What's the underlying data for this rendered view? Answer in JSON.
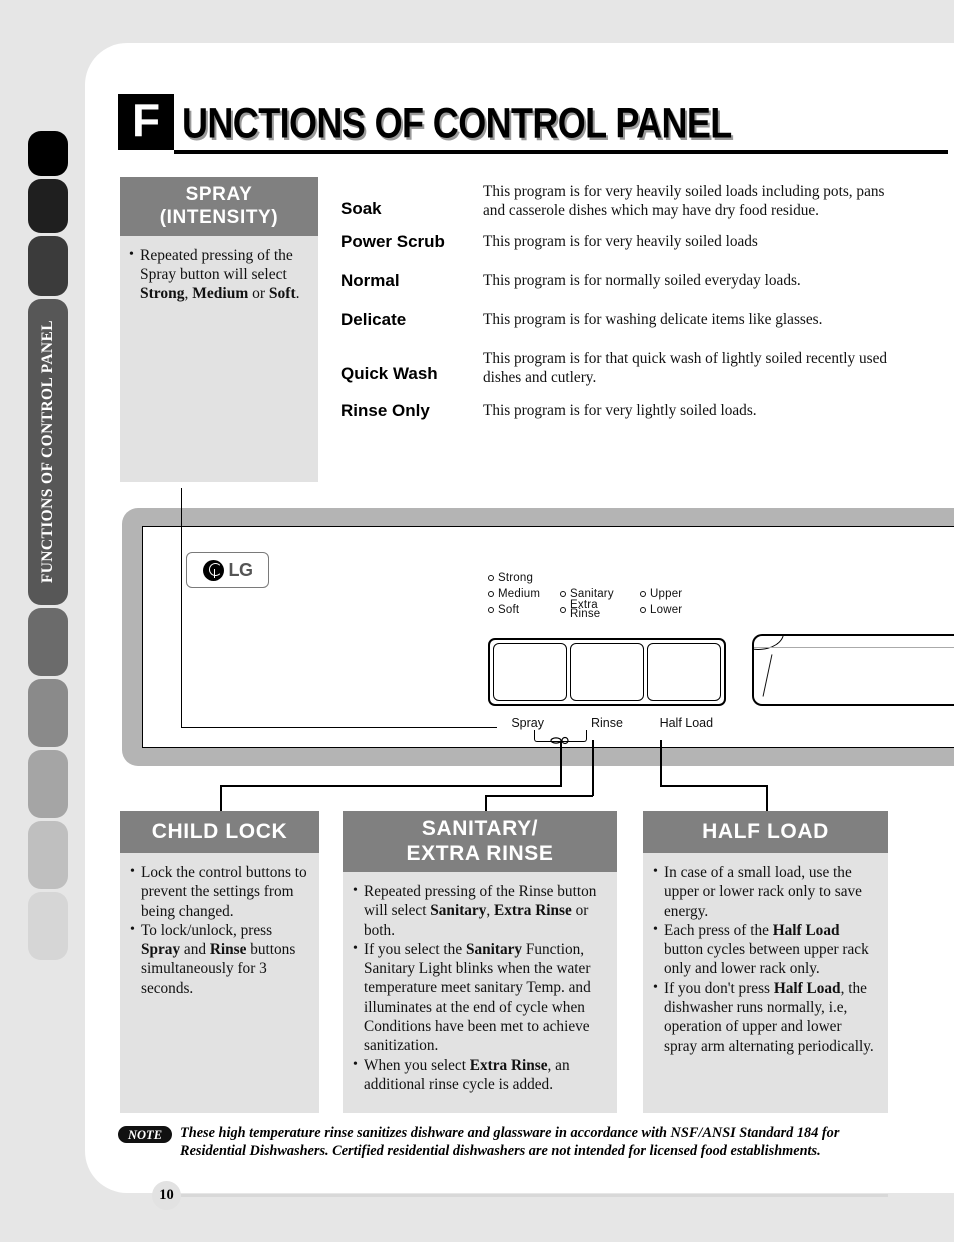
{
  "page": {
    "number": "10",
    "side_tab_label": "FUNCTIONS OF CONTROL PANEL"
  },
  "header": {
    "drop_cap": "F",
    "title": "UNCTIONS OF CONTROL PANEL"
  },
  "spray_panel": {
    "title_line1": "SPRAY",
    "title_line2": "(INTENSITY)",
    "bullets": [
      "Repeated pressing of the Spray button will select Strong, Medium or Soft."
    ]
  },
  "programs": [
    {
      "name": "Soak",
      "description": "This program is for very heavily soiled loads including pots, pans and casserole dishes which may have dry food residue."
    },
    {
      "name": "Power Scrub",
      "description": "This program is for very heavily soiled loads"
    },
    {
      "name": "Normal",
      "description": "This program is for normally soiled everyday loads."
    },
    {
      "name": "Delicate",
      "description": "This program is for washing delicate items like glasses."
    },
    {
      "name": "Quick Wash",
      "description": "This program is for that quick wash of lightly soiled recently used dishes and cutlery."
    },
    {
      "name": "Rinse Only",
      "description": "This program is for very lightly soiled  loads."
    }
  ],
  "control_panel": {
    "brand": "LG",
    "indicators_col1": [
      "Strong",
      "Medium",
      "Soft"
    ],
    "indicators_col2": [
      "Sanitary",
      "Extra",
      "Rinse"
    ],
    "indicators_col3": [
      "Upper",
      "Lower"
    ],
    "button_labels": [
      "Spray",
      "Rinse",
      "Half Load"
    ]
  },
  "boxes": [
    {
      "title": "CHILD LOCK",
      "bullets": [
        "Lock the control buttons to prevent the settings from being changed.",
        "To lock/unlock, press Spray and Rinse buttons simultaneously for 3 seconds."
      ]
    },
    {
      "title_line1": "SANITARY/",
      "title_line2": "EXTRA RINSE",
      "bullets": [
        "Repeated pressing of the Rinse button will select Sanitary, Extra Rinse or both.",
        "If you select the Sanitary Function, Sanitary Light blinks when the water temperature meet sanitary Temp. and illuminates at the end of cycle when Conditions have been met to achieve sanitization.",
        "When you select Extra Rinse, an additional rinse cycle is added."
      ]
    },
    {
      "title": "HALF LOAD",
      "bullets": [
        "In case of a small load, use the upper or lower rack only to save energy.",
        "Each press of the Half Load button cycles between upper rack only and lower rack only.",
        "If you don't press Half Load, the dishwasher runs normally, i.e, operation of upper and lower spray arm alternating periodically."
      ]
    }
  ],
  "note": {
    "label": "NOTE",
    "text": "These high temperature rinse sanitizes dishware and glassware in accordance with NSF/ANSI Standard 184 for Residential Dishwashers. Certified residential dishwashers are not intended for licensed food establishments."
  },
  "colors": {
    "page_bg": "#e6e6e6",
    "panel_header": "#808080",
    "panel_body": "#e2e2e2",
    "tab_active": "#575757",
    "cp_frame": "#b4b4b4"
  }
}
